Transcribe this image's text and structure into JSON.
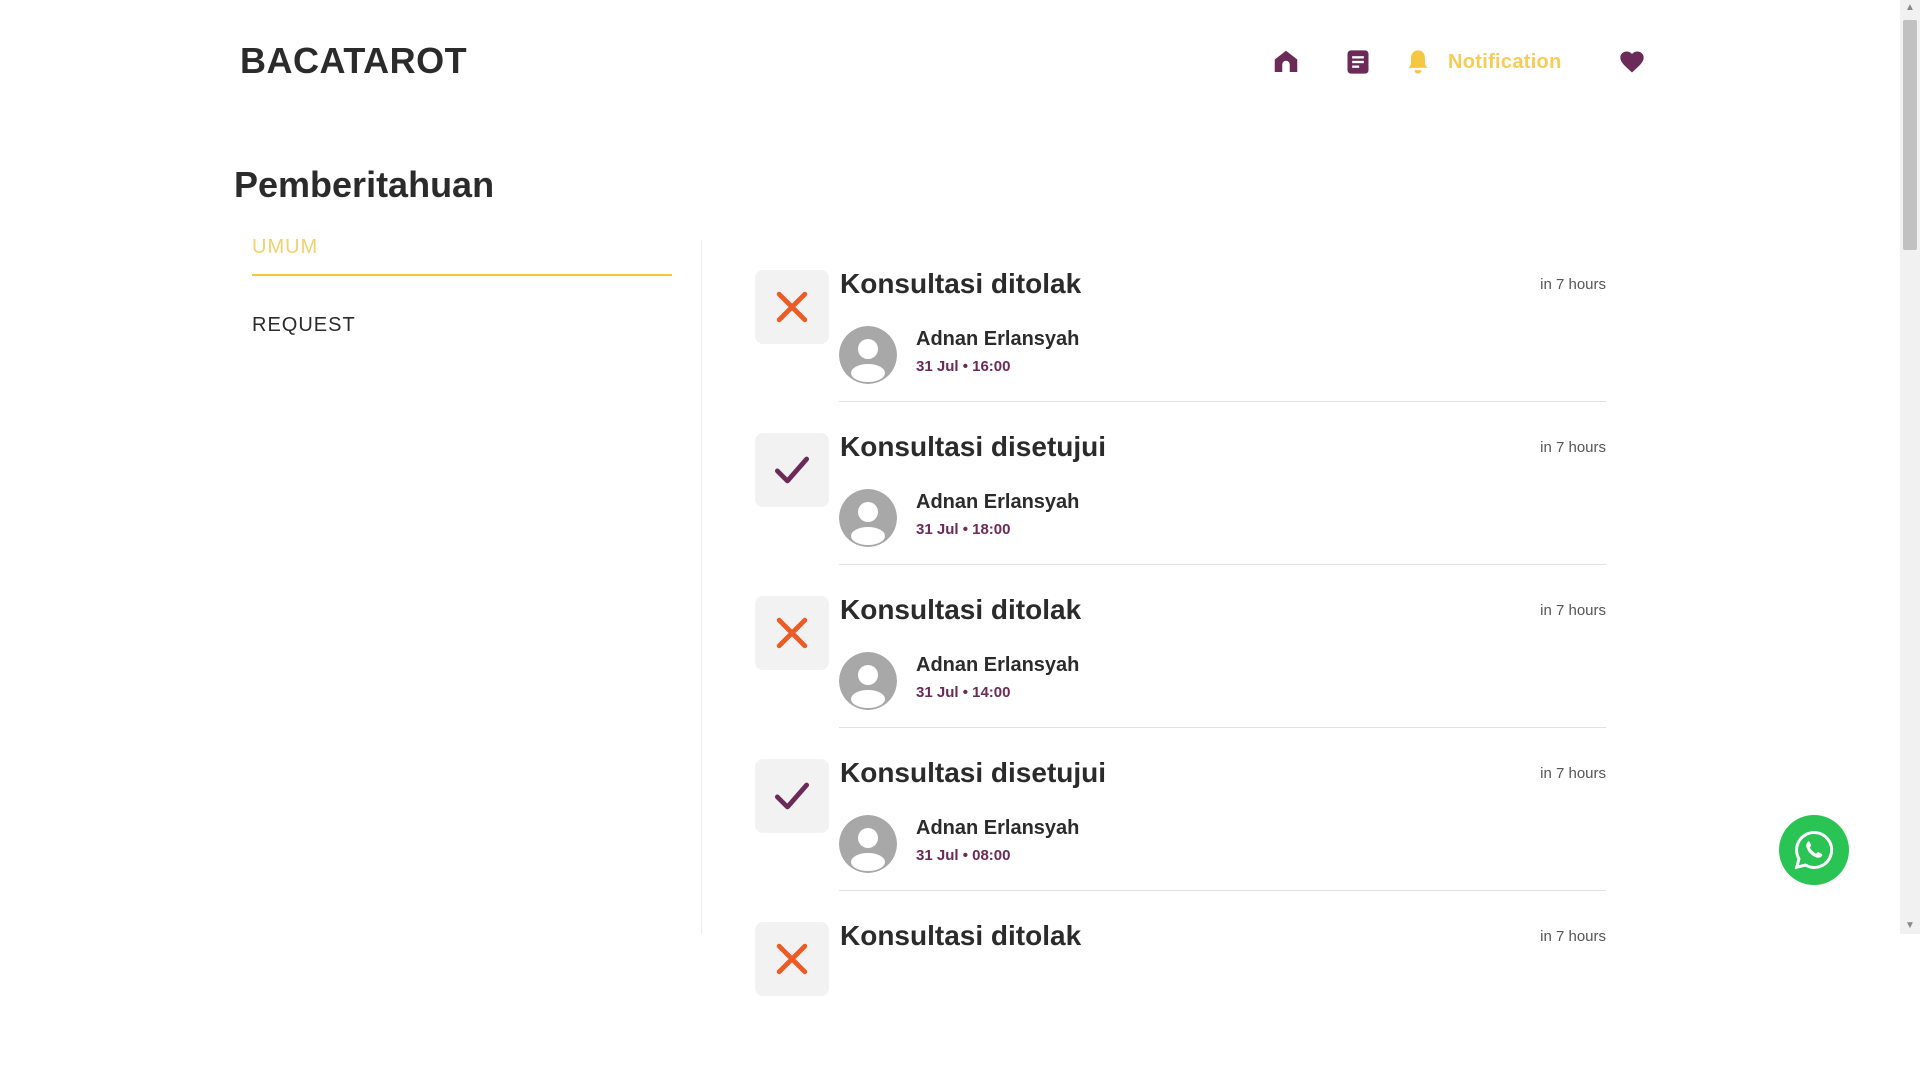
{
  "header": {
    "brand": "BACATAROT",
    "nav": {
      "home_icon": "home-icon",
      "doc_icon": "document-icon",
      "notification_icon": "bell-icon",
      "notification_label": "Notification",
      "favorite_icon": "heart-icon"
    }
  },
  "page": {
    "title": "Pemberitahuan"
  },
  "tabs": [
    {
      "label": "UMUM",
      "active": true
    },
    {
      "label": "REQUEST",
      "active": false
    }
  ],
  "notifications": [
    {
      "title": "Konsultasi ditolak",
      "status": "rejected",
      "time": "in 7 hours",
      "name": "Adnan Erlansyah",
      "when": "31 Jul • 16:00"
    },
    {
      "title": "Konsultasi disetujui",
      "status": "approved",
      "time": "in 7 hours",
      "name": "Adnan Erlansyah",
      "when": "31 Jul • 18:00"
    },
    {
      "title": "Konsultasi ditolak",
      "status": "rejected",
      "time": "in 7 hours",
      "name": "Adnan Erlansyah",
      "when": "31 Jul • 14:00"
    },
    {
      "title": "Konsultasi disetujui",
      "status": "approved",
      "time": "in 7 hours",
      "name": "Adnan Erlansyah",
      "when": "31 Jul • 08:00"
    },
    {
      "title": "Konsultasi ditolak",
      "status": "rejected",
      "time": "in 7 hours",
      "name": "",
      "when": ""
    }
  ],
  "colors": {
    "brand_purple": "#6b2a57",
    "accent_yellow": "#f5c842",
    "reject_orange": "#ee5a24",
    "whatsapp_green": "#29c454"
  },
  "floating": {
    "whatsapp_icon": "whatsapp-icon"
  }
}
